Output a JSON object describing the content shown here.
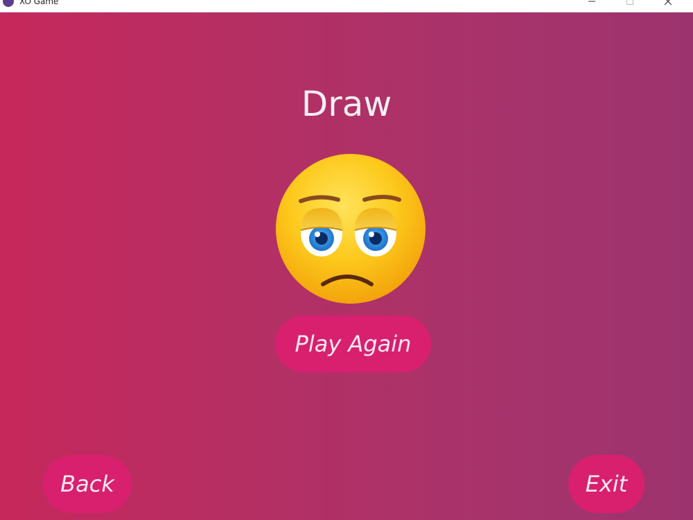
{
  "window": {
    "title": "XO Game",
    "controls": {
      "minimize_icon": "minimize-icon",
      "maximize_icon": "maximize-icon",
      "close_icon": "close-icon"
    }
  },
  "game": {
    "result_text": "Draw",
    "result_emoji": "neutral-face-emoji",
    "play_again_label": "Play Again",
    "back_label": "Back",
    "exit_label": "Exit"
  },
  "colors": {
    "background_left": "#c6285b",
    "background_right": "#9c336f",
    "button": "#d8206f",
    "text": "#f6eef3",
    "emoji_face": "#f6b913",
    "emoji_eye": "#1f7fd6"
  }
}
